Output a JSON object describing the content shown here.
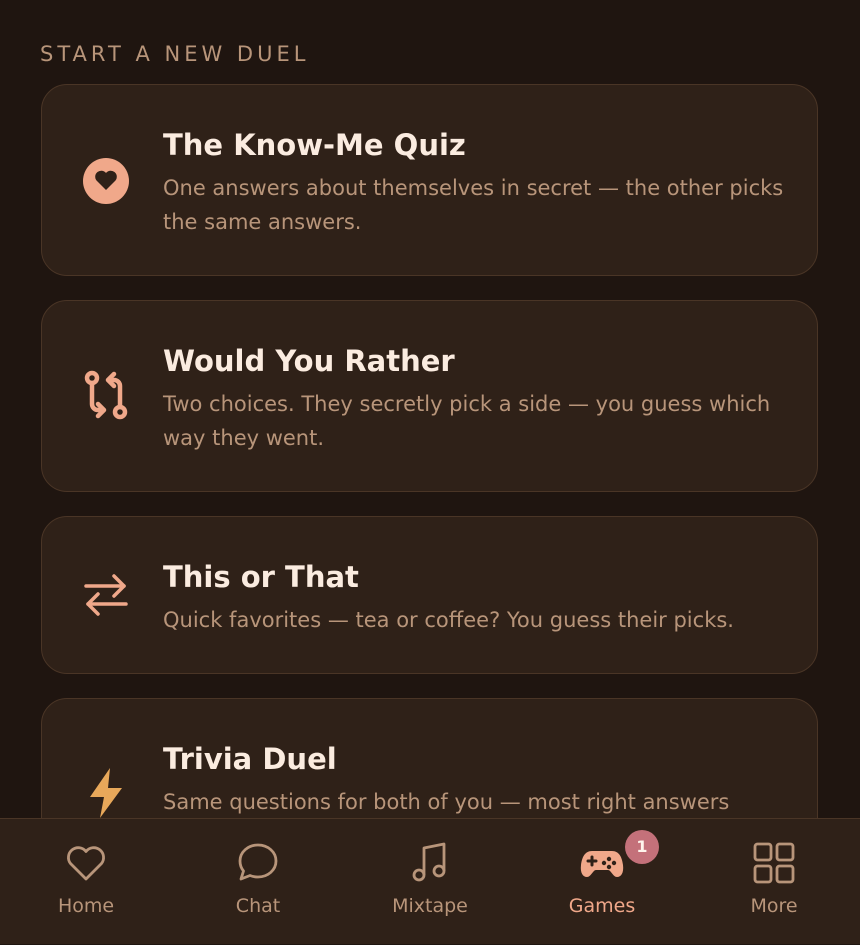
{
  "section_title": "START A NEW DUEL",
  "games": [
    {
      "title": "The Know-Me Quiz",
      "description": "One answers about themselves in secret — the other picks the same answers.",
      "icon": "heart-circle-icon"
    },
    {
      "title": "Would You Rather",
      "description": "Two choices. They secretly pick a side — you guess which way they went.",
      "icon": "swap-paths-icon"
    },
    {
      "title": "This or That",
      "description": "Quick favorites — tea or coffee? You guess their picks.",
      "icon": "arrows-exchange-icon"
    },
    {
      "title": "Trivia Duel",
      "description": "Same questions for both of you — most right answers",
      "icon": "lightning-icon"
    }
  ],
  "tabs": [
    {
      "label": "Home",
      "icon": "heart-icon"
    },
    {
      "label": "Chat",
      "icon": "chat-bubble-icon"
    },
    {
      "label": "Mixtape",
      "icon": "music-note-icon"
    },
    {
      "label": "Games",
      "icon": "gamepad-icon",
      "active": true,
      "badge": "1"
    },
    {
      "label": "More",
      "icon": "grid-icon"
    }
  ],
  "colors": {
    "background": "#1f1510",
    "card": "#2f2118",
    "accent": "#f0a88a",
    "text": "#fbece0",
    "muted": "#b8957a",
    "badge": "#c4717a",
    "lightning": "#e8a85a"
  }
}
